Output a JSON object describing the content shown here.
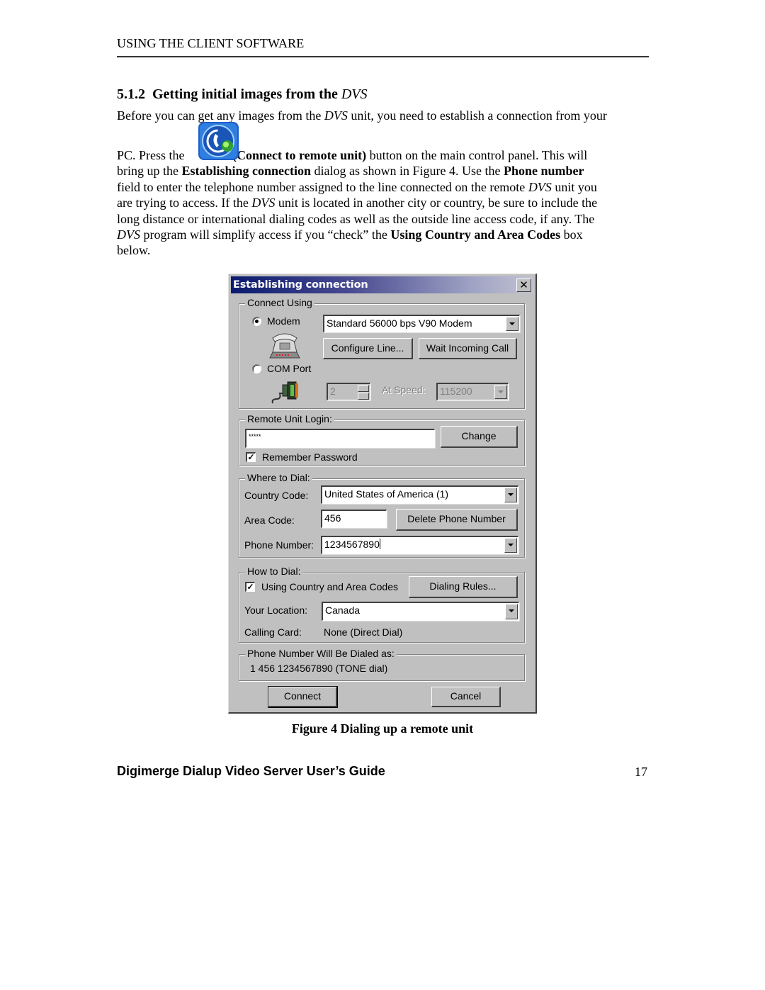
{
  "running_head": "USING THE CLIENT SOFTWARE",
  "section": {
    "number": "5.1.2",
    "title_plain": "Getting initial images from the ",
    "title_italic": "DVS"
  },
  "paragraph": {
    "l1_a": "Before you can get any images from the ",
    "l1_dvs": "DVS",
    "l1_b": " unit, you need to establish a connection from your",
    "l2_a": "PC.  Press the ",
    "l2_bold": "(Connect to remote unit)",
    "l2_b": " button on the main control panel.  This will",
    "l3_a": "bring up the ",
    "l3_bold": "Establishing connection",
    "l3_b": " dialog as shown in Figure 4.  Use the ",
    "l3_bold2": "Phone number",
    "l4_a": "field to enter the telephone number assigned to the line connected on the remote ",
    "l4_dvs": "DVS",
    "l4_b": " unit you",
    "l5_a": "are trying to access.  If the ",
    "l5_dvs": "DVS",
    "l5_b": " unit is located in another city or country, be sure to include the",
    "l6": "long distance or international dialing codes as well as the outside line access code, if any.  The",
    "l7_dvs": "DVS",
    "l7_a": " program will simplify access if you “check” the ",
    "l7_bold": "Using Country and Area Codes",
    "l7_b": " box",
    "l8": "below.",
    "inline_icon": "connect-to-remote-unit-icon"
  },
  "dialog": {
    "title": "Establishing connection",
    "close_glyph": "✕",
    "connect_using": {
      "label": "Connect Using",
      "modem_label": "Modem",
      "modem_selected": true,
      "modem_value": "Standard 56000 bps V90 Modem",
      "configure_line": "Configure Line...",
      "wait_incoming_call": "Wait Incoming Call",
      "com_port_label": "COM Port",
      "com_port_selected": false,
      "com_port_value": "2",
      "at_speed_label": "At Speed:",
      "at_speed_value": "115200"
    },
    "remote_login": {
      "label": "Remote Unit Login:",
      "password_value": "*****",
      "change": "Change",
      "remember_password": "Remember Password",
      "remember_checked": true
    },
    "where_to_dial": {
      "label": "Where to Dial:",
      "country_code_label": "Country Code:",
      "country_code_value": "United States of America (1)",
      "area_code_label": "Area Code:",
      "area_code_value": "456",
      "delete_phone": "Delete Phone Number",
      "phone_number_label": "Phone Number:",
      "phone_number_value": "1234567890"
    },
    "how_to_dial": {
      "label": "How to Dial:",
      "use_codes_label": "Using Country and Area Codes",
      "use_codes_checked": true,
      "dialing_rules": "Dialing Rules...",
      "location_label": "Your Location:",
      "location_value": "Canada",
      "calling_card_label": "Calling Card:",
      "calling_card_value": "None (Direct Dial)"
    },
    "dialed_as": {
      "label": "Phone Number Will Be Dialed as:",
      "value": "1 456 1234567890 (TONE dial)"
    },
    "connect": "Connect",
    "cancel": "Cancel"
  },
  "figure_caption": "Figure 4 Dialing up a remote unit",
  "footer": {
    "title": "Digimerge Dialup Video Server User’s Guide",
    "page_number": "17"
  }
}
